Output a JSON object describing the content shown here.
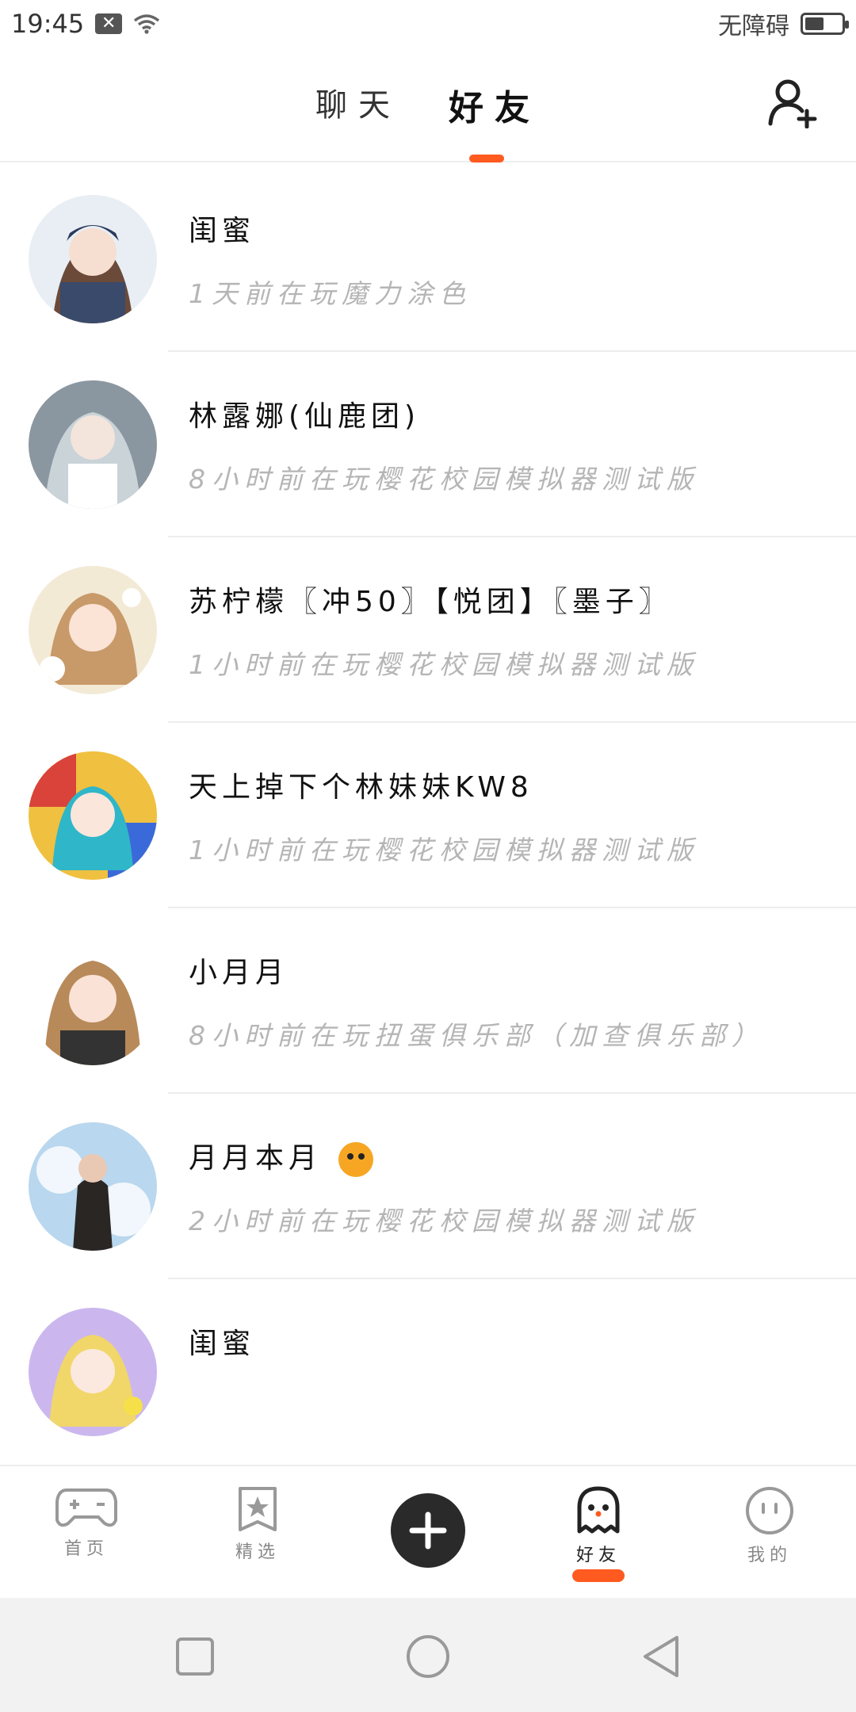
{
  "status_bar": {
    "time": "19:45",
    "accessibility": "无障碍",
    "battery_level": 0.45,
    "icons": [
      "notification-icon",
      "wifi-icon",
      "battery-icon"
    ]
  },
  "header": {
    "tabs": [
      {
        "label": "聊天",
        "active": false
      },
      {
        "label": "好友",
        "active": true
      }
    ],
    "accent_color": "#ff5a1f",
    "add_friend_icon": "add-user-icon"
  },
  "friends": [
    {
      "name": "闺蜜",
      "status": "1天前在玩魔力涂色"
    },
    {
      "name": "林露娜(仙鹿团)",
      "status": "8小时前在玩樱花校园模拟器测试版"
    },
    {
      "name": "苏柠檬〖冲50〗【悦团】〖墨子〗",
      "status": "1小时前在玩樱花校园模拟器测试版"
    },
    {
      "name": "天上掉下个林妹妹KW8",
      "status": "1小时前在玩樱花校园模拟器测试版"
    },
    {
      "name": "小月月",
      "status": "8小时前在玩扭蛋俱乐部（加查俱乐部）"
    },
    {
      "name": "月月本月",
      "status": "2小时前在玩樱花校园模拟器测试版"
    },
    {
      "name": "闺蜜",
      "status": ""
    }
  ],
  "bottom_nav": {
    "items": [
      {
        "label": "首页",
        "icon": "gamepad-icon",
        "active": false
      },
      {
        "label": "精选",
        "icon": "star-bookmark-icon",
        "active": false
      },
      {
        "label": "",
        "icon": "plus-icon",
        "active": false
      },
      {
        "label": "好友",
        "icon": "ghost-icon",
        "active": true
      },
      {
        "label": "我的",
        "icon": "face-icon",
        "active": false
      }
    ]
  },
  "system_nav": {
    "icons": [
      "recent-apps-icon",
      "home-icon",
      "back-icon"
    ]
  }
}
